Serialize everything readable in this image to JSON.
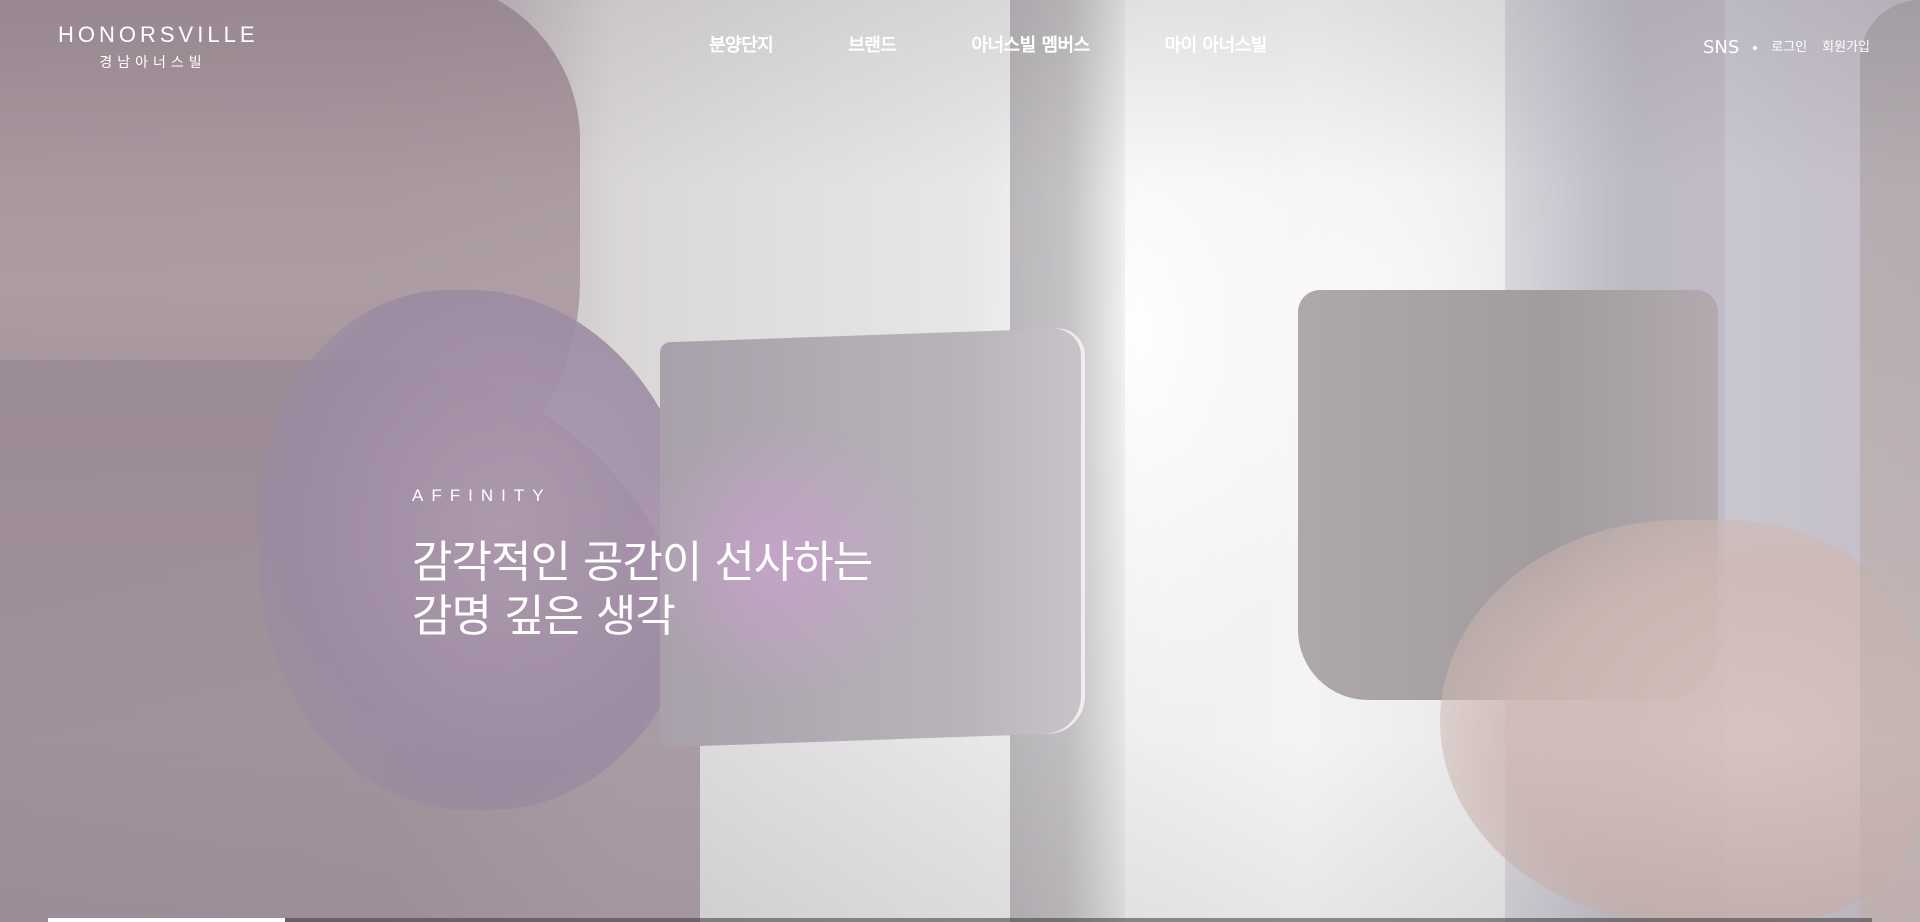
{
  "header": {
    "logo_en": "HONORSVILLE",
    "logo_ko": "경남아너스빌",
    "nav": [
      "분양단지",
      "브랜드",
      "아너스빌 멤버스",
      "마이 아너스빌"
    ],
    "util": {
      "sns": "SNS",
      "login": "로그인",
      "join": "회원가입"
    }
  },
  "hero": {
    "eyebrow": "AFFINITY",
    "headline": [
      "감각적인 공간이 선사하는",
      "감명 깊은 생각"
    ],
    "progress": 0.13
  },
  "colors": {
    "text": "#ffffff",
    "progress_track": "#3c3c3c",
    "progress_fill": "#ffffff"
  }
}
